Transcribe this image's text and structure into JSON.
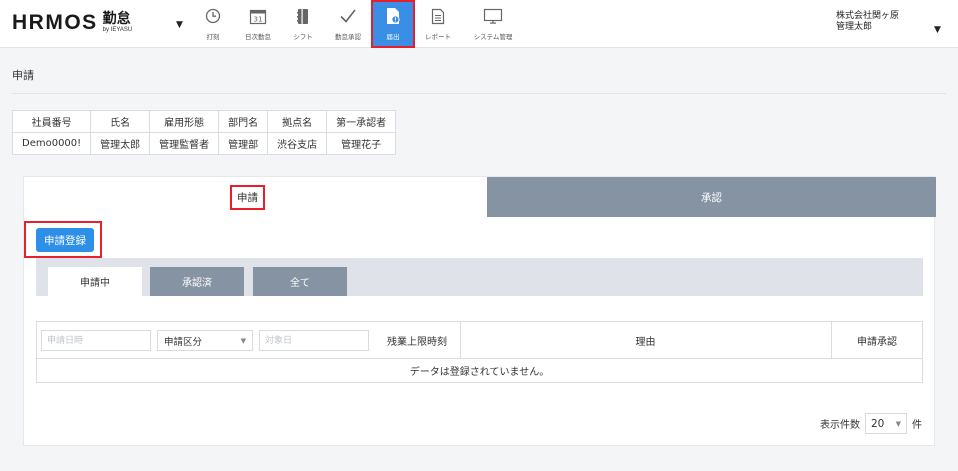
{
  "header": {
    "logo_main": "HRMOS",
    "logo_sub": "勤怠",
    "logo_by": "by IEYASU",
    "nav": [
      {
        "label": "打刻",
        "icon": "clock-icon"
      },
      {
        "label": "日次勤怠",
        "icon": "calendar-icon"
      },
      {
        "label": "シフト",
        "icon": "shift-icon"
      },
      {
        "label": "勤怠承認",
        "icon": "check-icon"
      },
      {
        "label": "届出",
        "icon": "request-icon"
      },
      {
        "label": "レポート",
        "icon": "report-icon"
      },
      {
        "label": "システム管理",
        "icon": "monitor-icon"
      }
    ],
    "active_nav": "届出",
    "company": "株式会社関ヶ原",
    "user": "管理太郎"
  },
  "page": {
    "title": "申請"
  },
  "employee": {
    "headers": [
      "社員番号",
      "氏名",
      "雇用形態",
      "部門名",
      "拠点名",
      "第一承認者"
    ],
    "values": [
      "Demo0000!",
      "管理太郎",
      "管理監督者",
      "管理部",
      "渋谷支店",
      "管理花子"
    ]
  },
  "tabs": {
    "apply": "申請",
    "approve": "承認"
  },
  "register_button": "申請登録",
  "subtabs": [
    "申請中",
    "承認済",
    "全て"
  ],
  "grid": {
    "date_placeholder": "申請日時",
    "category_select": "申請区分",
    "target_placeholder": "対象日",
    "overtime_col": "残業上限時刻",
    "reason_col": "理由",
    "approval_col": "申請承認",
    "empty_message": "データは登録されていません。"
  },
  "pager": {
    "label": "表示件数",
    "value": "20",
    "unit": "件"
  },
  "colors": {
    "accent": "#3a8ee6",
    "tab_inactive": "#8593a3",
    "highlight": "#e5202b"
  }
}
